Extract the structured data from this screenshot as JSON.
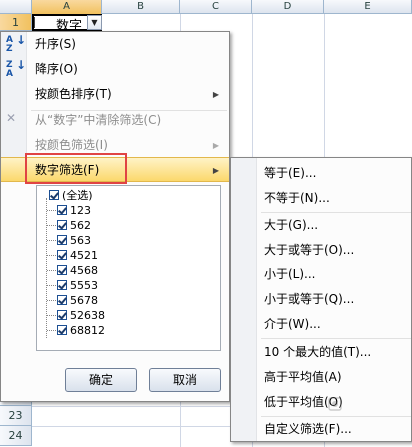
{
  "columns": [
    "A",
    "B",
    "C",
    "D",
    "E"
  ],
  "rows": [
    "1",
    "23",
    "24"
  ],
  "cell_a1": "数字",
  "menu": {
    "sort_asc": "升序(S)",
    "sort_desc": "降序(O)",
    "sort_color": "按颜色排序(T)",
    "clear_filter": "从“数字”中清除筛选(C)",
    "filter_color": "按颜色筛选(I)",
    "number_filter": "数字筛选(F)"
  },
  "checklist": [
    "(全选)",
    "123",
    "562",
    "563",
    "4521",
    "4568",
    "5553",
    "5678",
    "52638",
    "68812"
  ],
  "buttons": {
    "ok": "确定",
    "cancel": "取消"
  },
  "submenu": {
    "equals": "等于(E)...",
    "not_equals": "不等于(N)...",
    "greater": "大于(G)...",
    "greater_eq": "大于或等于(O)...",
    "less": "小于(L)...",
    "less_eq": "小于或等于(Q)...",
    "between": "介于(W)...",
    "top10": "10 个最大的值(T)...",
    "above_avg": "高于平均值(A)",
    "below_avg": "低于平均值(O)",
    "custom": "自定义筛选(F)..."
  },
  "icons": [
    "sort-asc-icon",
    "sort-desc-icon",
    "clear-filter-icon",
    "chevron-right-icon",
    "checkbox-checked-icon",
    "dropdown-arrow-icon"
  ],
  "colors": {
    "highlight": "#fbd86c",
    "highlight_border": "#e04444",
    "header_selected": "#f1c15f"
  }
}
